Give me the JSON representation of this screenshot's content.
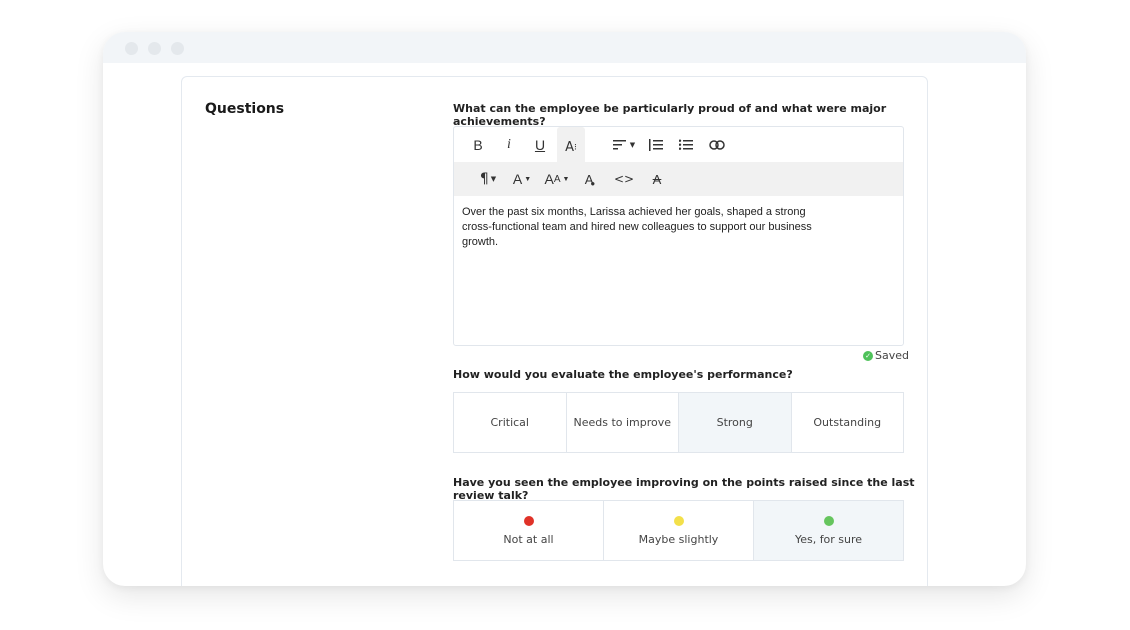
{
  "window": {
    "controls": [
      "close",
      "minimize",
      "maximize"
    ]
  },
  "section": {
    "title": "Questions"
  },
  "question1": {
    "label": "What can the employee be particularly proud of and what were major achievements?",
    "toolbar_row1": [
      {
        "icon": "bold-icon",
        "glyph": "B"
      },
      {
        "icon": "italic-icon",
        "glyph": "i"
      },
      {
        "icon": "underline-icon",
        "glyph": "U"
      },
      {
        "icon": "font-size-icon",
        "glyph": "A⁝"
      },
      {
        "icon": "align-icon",
        "glyph": "≡"
      },
      {
        "icon": "ordered-list-icon",
        "glyph": "☰"
      },
      {
        "icon": "unordered-list-icon",
        "glyph": "☰"
      },
      {
        "icon": "link-icon",
        "glyph": "⊂⊃"
      }
    ],
    "toolbar_row2": [
      {
        "icon": "paragraph-icon",
        "glyph": "¶"
      },
      {
        "icon": "font-family-icon",
        "glyph": "A"
      },
      {
        "icon": "text-case-icon",
        "glyph": "AA"
      },
      {
        "icon": "text-color-icon",
        "glyph": "A"
      },
      {
        "icon": "code-icon",
        "glyph": "<>"
      },
      {
        "icon": "clear-format-icon",
        "glyph": "A̸"
      }
    ],
    "content": "Over the past six months, Larissa achieved her goals, shaped a strong cross-functional team and hired new colleagues to support our business growth.",
    "status": "Saved"
  },
  "question2": {
    "label": "How would you evaluate the employee's performance?",
    "options": [
      "Critical",
      "Needs to improve",
      "Strong",
      "Outstanding"
    ],
    "selected": "Strong"
  },
  "question3": {
    "label": "Have you seen the employee improving on the points raised since the last review talk?",
    "options": [
      {
        "label": "Not at all",
        "color": "#e03228"
      },
      {
        "label": "Maybe slightly",
        "color": "#f3e04a"
      },
      {
        "label": "Yes, for sure",
        "color": "#66c55e"
      }
    ],
    "selected": "Yes, for sure"
  }
}
